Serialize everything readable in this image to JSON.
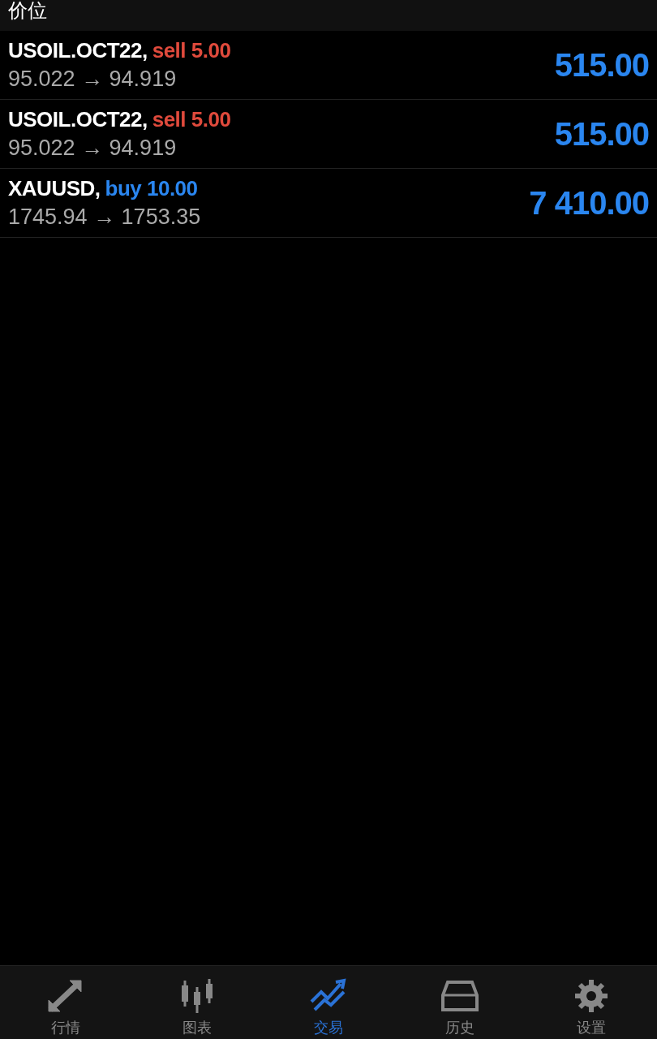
{
  "section_header": {
    "title": "价位"
  },
  "positions": [
    {
      "symbol": "USOIL.OCT22,",
      "side": "sell",
      "volume": "5.00",
      "prices": "95.022 → 94.919",
      "profit": "515.00"
    },
    {
      "symbol": "USOIL.OCT22,",
      "side": "sell",
      "volume": "5.00",
      "prices": "95.022 → 94.919",
      "profit": "515.00"
    },
    {
      "symbol": "XAUUSD,",
      "side": "buy",
      "volume": "10.00",
      "prices": "1745.94 → 1753.35",
      "profit": "7 410.00"
    }
  ],
  "tab_bar": [
    {
      "kind": "quotes",
      "label": "行情",
      "selected": false
    },
    {
      "kind": "chart",
      "label": "图表",
      "selected": false
    },
    {
      "kind": "trade",
      "label": "交易",
      "selected": true
    },
    {
      "kind": "history",
      "label": "历史",
      "selected": false
    },
    {
      "kind": "settings",
      "label": "设置",
      "selected": false
    }
  ]
}
